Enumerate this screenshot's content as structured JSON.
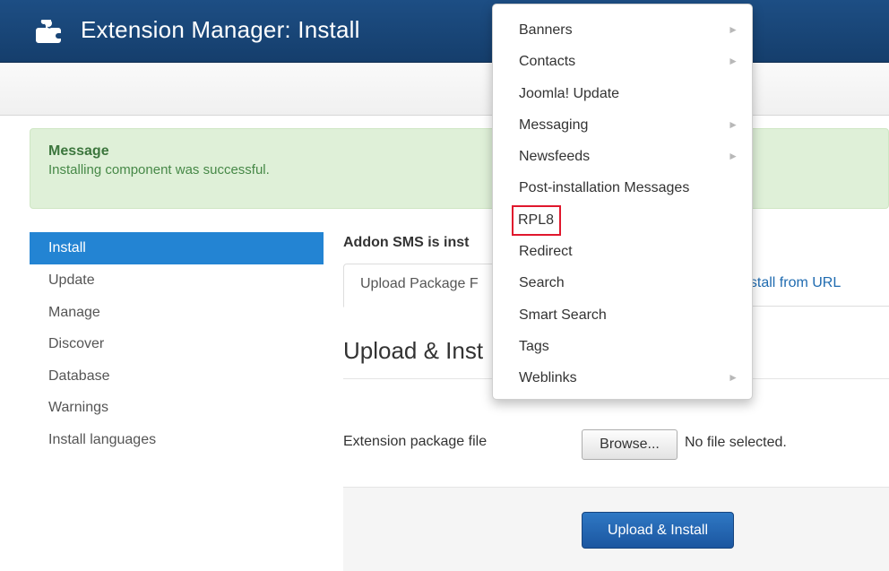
{
  "header": {
    "title": "Extension Manager: Install",
    "icon": "puzzle-icon"
  },
  "message": {
    "title": "Message",
    "text": "Installing component was successful."
  },
  "sidebar": {
    "items": [
      {
        "label": "Install",
        "active": true
      },
      {
        "label": "Update"
      },
      {
        "label": "Manage"
      },
      {
        "label": "Discover"
      },
      {
        "label": "Database"
      },
      {
        "label": "Warnings"
      },
      {
        "label": "Install languages"
      }
    ]
  },
  "main": {
    "addon_message": "Addon SMS is inst",
    "tabs": {
      "upload": "Upload Package F",
      "url": "nstall from URL"
    },
    "section_title": "Upload & Inst",
    "file_label": "Extension package file",
    "browse_label": "Browse...",
    "no_file_text": "No file selected.",
    "upload_button": "Upload & Install"
  },
  "dropdown": {
    "items": [
      {
        "label": "Banners",
        "submenu": true
      },
      {
        "label": "Contacts",
        "submenu": true
      },
      {
        "label": "Joomla! Update"
      },
      {
        "label": "Messaging",
        "submenu": true
      },
      {
        "label": "Newsfeeds",
        "submenu": true
      },
      {
        "label": "Post-installation Messages"
      },
      {
        "label": "RPL8",
        "highlighted": true
      },
      {
        "label": "Redirect"
      },
      {
        "label": "Search"
      },
      {
        "label": "Smart Search"
      },
      {
        "label": "Tags"
      },
      {
        "label": "Weblinks",
        "submenu": true
      }
    ]
  },
  "colors": {
    "header_bg": "#1d4e84",
    "sidebar_active": "#2384d3",
    "message_bg": "#dff0d8",
    "primary_button": "#2f78c4",
    "highlight_box": "#e0182d"
  }
}
